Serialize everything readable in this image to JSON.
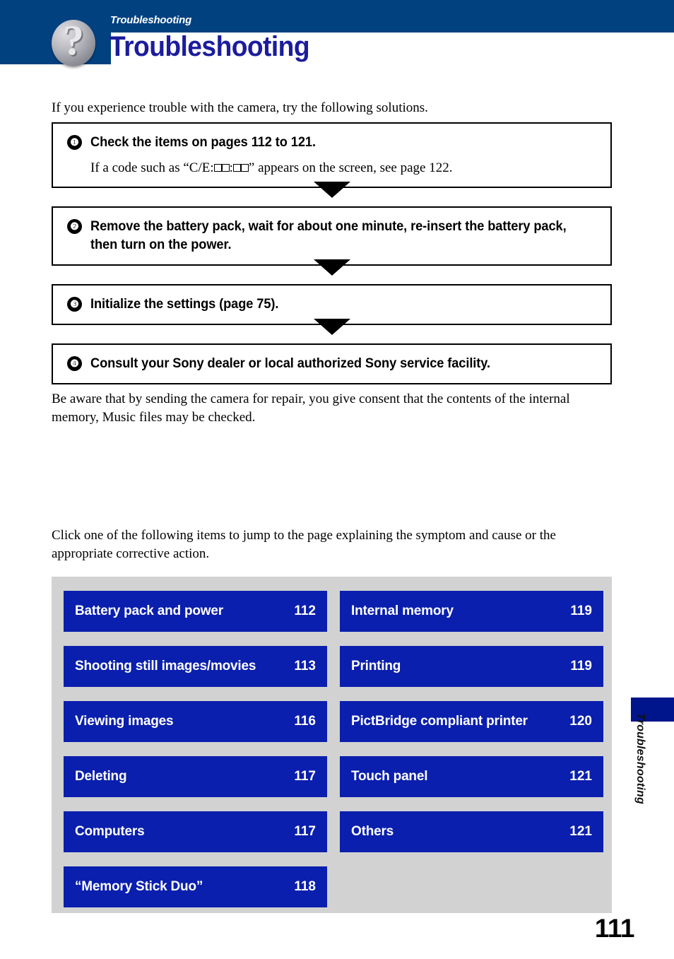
{
  "header": {
    "kicker": "Troubleshooting",
    "title": "Troubleshooting",
    "icon": "question-mark-icon",
    "bar_color": "#014180",
    "title_color": "#1c1c9c"
  },
  "intro": "If you experience trouble with the camera, try the following solutions.",
  "steps": [
    {
      "number": "❶",
      "heading": "Check the items on pages 112 to 121.",
      "sub_prefix": "If a code such as “C/E:",
      "sub_mid": ":",
      "sub_suffix": "” appears on the screen, see page 122."
    },
    {
      "number": "❷",
      "heading": "Remove the battery pack, wait for about one minute, re-insert the battery pack, then turn on the power."
    },
    {
      "number": "❸",
      "heading": "Initialize the settings (page 75)."
    },
    {
      "number": "❹",
      "heading": "Consult your Sony dealer or local authorized Sony service facility."
    }
  ],
  "note": "Be aware that by sending the camera for repair, you give consent that the contents of the internal memory, Music files may be checked.",
  "clickinfo": "Click one of the following items to jump to the page explaining the symptom and cause or the appropriate corrective action.",
  "links": {
    "background_color": "#d2d2d2",
    "button_color": "#0a1fad",
    "left": [
      {
        "label": "Battery pack and power",
        "page": "112"
      },
      {
        "label": "Shooting still images/movies",
        "page": "113"
      },
      {
        "label": "Viewing images",
        "page": "116"
      },
      {
        "label": "Deleting",
        "page": "117"
      },
      {
        "label": "Computers",
        "page": "117"
      },
      {
        "label": "“Memory Stick Duo”",
        "page": "118"
      }
    ],
    "right": [
      {
        "label": "Internal memory",
        "page": "119"
      },
      {
        "label": "Printing",
        "page": "119"
      },
      {
        "label": "PictBridge compliant printer",
        "page": "120"
      },
      {
        "label": "Touch panel",
        "page": "121"
      },
      {
        "label": "Others",
        "page": "121"
      }
    ]
  },
  "sidetab": {
    "label": "Troubleshooting",
    "bar_color": "#00148c"
  },
  "page_number": "111"
}
